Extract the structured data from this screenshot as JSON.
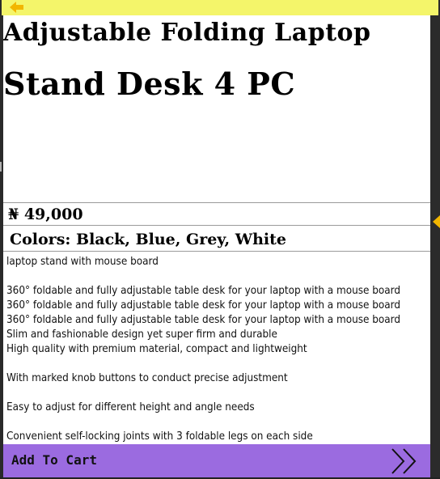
{
  "product": {
    "title_line_1": "Adjustable Folding Laptop",
    "title_line_2": "Stand Desk 4 PC",
    "price": "₦ 49,000",
    "colors": "Colors: Black, Blue, Grey, White"
  },
  "description": [
    "laptop stand with mouse board",
    "",
    "360° foldable and fully adjustable table desk for your laptop with a mouse board",
    "360° foldable and fully adjustable table desk for your laptop with a mouse board",
    "360° foldable and fully adjustable table desk for your laptop with a mouse board",
    "Slim and fashionable design yet super firm and durable",
    "High quality with premium material, compact and lightweight",
    "",
    "With marked knob buttons to conduct precise adjustment",
    "",
    "Easy to adjust for different height and angle needs",
    "",
    "Convenient self-locking joints with 3 foldable legs on each side"
  ],
  "cart": {
    "label": "Add To Cart"
  },
  "icons": {
    "back": "back-arrow-icon",
    "next": "double-chevron-right-icon",
    "side": "triangle-right-icon"
  },
  "colors_theme": {
    "top_bar": "#f4f56a",
    "cart_bar": "#9b6be0",
    "accent_arrow": "#f2b600"
  }
}
